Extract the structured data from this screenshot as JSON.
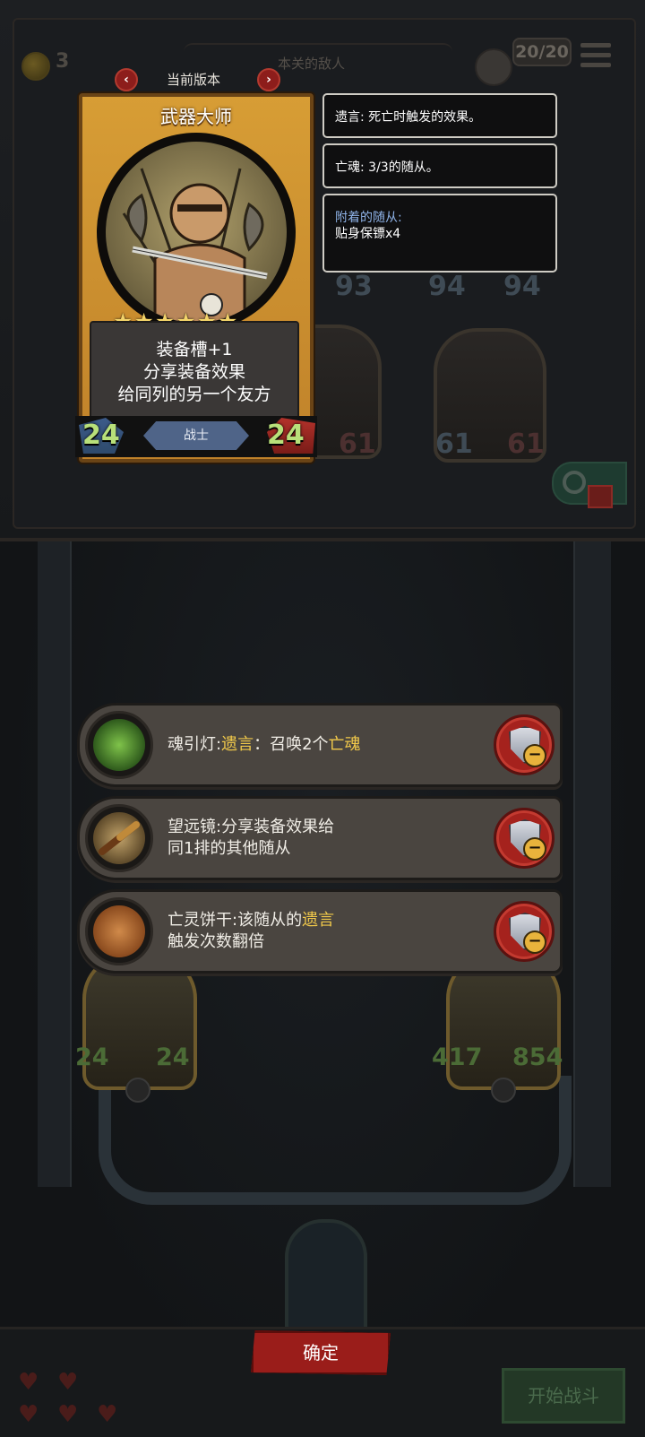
{
  "top_bar": {
    "gold_count": "3",
    "enemy_title": "本关的敌人",
    "turn_counter": "20/20"
  },
  "card": {
    "version_label": "当前版本",
    "prev_icon": "‹",
    "next_icon": "›",
    "name": "武器大师",
    "stars": "★★★★★★",
    "star_count": 6,
    "description": [
      "装备槽+1",
      "分享装备效果",
      "给同列的另一个友方"
    ],
    "class_label": "战士",
    "attack": "24",
    "health": "24"
  },
  "info_boxes": {
    "deathrattle": "遗言: 死亡时触发的效果。",
    "ghost": "亡魂: 3/3的随从。",
    "attached_label": "附着的随从:",
    "attached_value": "贴身保镖x4"
  },
  "board_top_dimmed": {
    "unit1_health": "93",
    "unit2_attack": "94",
    "unit2_health": "94",
    "unit3_attack": "61",
    "unit3_health": "61",
    "unit4_attack": "61",
    "unit4_health": "61"
  },
  "items": [
    {
      "name": "魂引灯",
      "sep": ":",
      "hl1": "遗言",
      "mid": "：召唤2个",
      "hl2": "亡魂",
      "tail": ""
    },
    {
      "line1": "望远镜:分享装备效果给",
      "line2": "同1排的其他随从"
    },
    {
      "line1_pre": "亡灵饼干:该随从的",
      "line1_hl": "遗言",
      "line2": "触发次数翻倍"
    }
  ],
  "board_bottom": {
    "left_unit_attack": "24",
    "left_unit_health": "24",
    "right_unit_attack": "417",
    "right_unit_health": "854"
  },
  "buttons": {
    "confirm": "确定",
    "start_battle": "开始战斗"
  },
  "colors": {
    "highlight": "#f1c94a",
    "confirm_red": "#9a1d1a",
    "card_gold": "#d79d35",
    "class_blue": "#4f6488"
  }
}
